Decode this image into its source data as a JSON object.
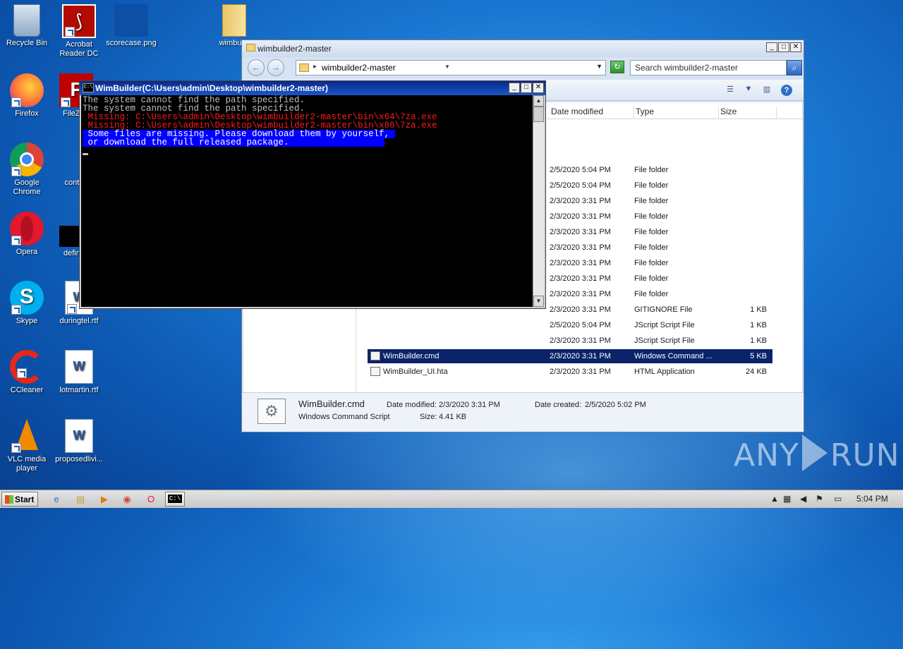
{
  "desktop": {
    "icons": [
      {
        "label": "Recycle Bin"
      },
      {
        "label": "Acrobat Reader DC"
      },
      {
        "label": "scorecase.png"
      },
      {
        "label": "wimbuild"
      },
      {
        "label": "Firefox"
      },
      {
        "label": "FileZilla"
      },
      {
        "label": "Google Chrome"
      },
      {
        "label": "control"
      },
      {
        "label": "Opera"
      },
      {
        "label": "defined"
      },
      {
        "label": "Skype"
      },
      {
        "label": "duringtel.rtf"
      },
      {
        "label": "CCleaner"
      },
      {
        "label": "lotmartin.rtf"
      },
      {
        "label": "VLC media player"
      },
      {
        "label": "proposedlivi..."
      }
    ]
  },
  "explorer": {
    "title": "wimbuilder2-master",
    "address_crumb": "wimbuilder2-master",
    "search_placeholder": "Search wimbuilder2-master",
    "columns": {
      "date": "Date modified",
      "type": "Type",
      "size": "Size"
    },
    "rows": [
      {
        "name": "",
        "date": "2/5/2020 5:04 PM",
        "type": "File folder",
        "size": ""
      },
      {
        "name": "",
        "date": "2/5/2020 5:04 PM",
        "type": "File folder",
        "size": ""
      },
      {
        "name": "",
        "date": "2/3/2020 3:31 PM",
        "type": "File folder",
        "size": ""
      },
      {
        "name": "",
        "date": "2/3/2020 3:31 PM",
        "type": "File folder",
        "size": ""
      },
      {
        "name": "",
        "date": "2/3/2020 3:31 PM",
        "type": "File folder",
        "size": ""
      },
      {
        "name": "",
        "date": "2/3/2020 3:31 PM",
        "type": "File folder",
        "size": ""
      },
      {
        "name": "",
        "date": "2/3/2020 3:31 PM",
        "type": "File folder",
        "size": ""
      },
      {
        "name": "",
        "date": "2/3/2020 3:31 PM",
        "type": "File folder",
        "size": ""
      },
      {
        "name": "",
        "date": "2/3/2020 3:31 PM",
        "type": "File folder",
        "size": ""
      },
      {
        "name": "",
        "date": "2/3/2020 3:31 PM",
        "type": "GITIGNORE File",
        "size": "1 KB"
      },
      {
        "name": "",
        "date": "2/5/2020 5:04 PM",
        "type": "JScript Script File",
        "size": "1 KB"
      },
      {
        "name": "",
        "date": "2/3/2020 3:31 PM",
        "type": "JScript Script File",
        "size": "1 KB"
      },
      {
        "name": "WimBuilder.cmd",
        "date": "2/3/2020 3:31 PM",
        "type": "Windows Command ...",
        "size": "5 KB"
      },
      {
        "name": "WimBuilder_UI.hta",
        "date": "2/3/2020 3:31 PM",
        "type": "HTML Application",
        "size": "24 KB"
      }
    ],
    "details": {
      "name": "WimBuilder.cmd",
      "kind": "Windows Command Script",
      "date_modified_label": "Date modified:",
      "date_modified": "2/3/2020 3:31 PM",
      "date_created_label": "Date created:",
      "date_created": "2/5/2020 5:02 PM",
      "size_label": "Size:",
      "size": "4.41 KB"
    }
  },
  "cmd": {
    "title": "WimBuilder(C:\\Users\\admin\\Desktop\\wimbuilder2-master)",
    "icon_text": "C:\\",
    "lines": [
      "The system cannot find the path specified.",
      "The system cannot find the path specified.",
      " Missing: C:\\Users\\admin\\Desktop\\wimbuilder2-master\\bin\\x64\\7za.exe",
      " Missing: C:\\Users\\admin\\Desktop\\wimbuilder2-master\\bin\\x86\\7za.exe",
      " Some files are missing. Please download them by yourself, ",
      " or download the full released package.                  "
    ]
  },
  "watermark": {
    "left": "ANY",
    "right": "RUN"
  },
  "taskbar": {
    "start_label": "Start",
    "clock": "5:04 PM"
  }
}
